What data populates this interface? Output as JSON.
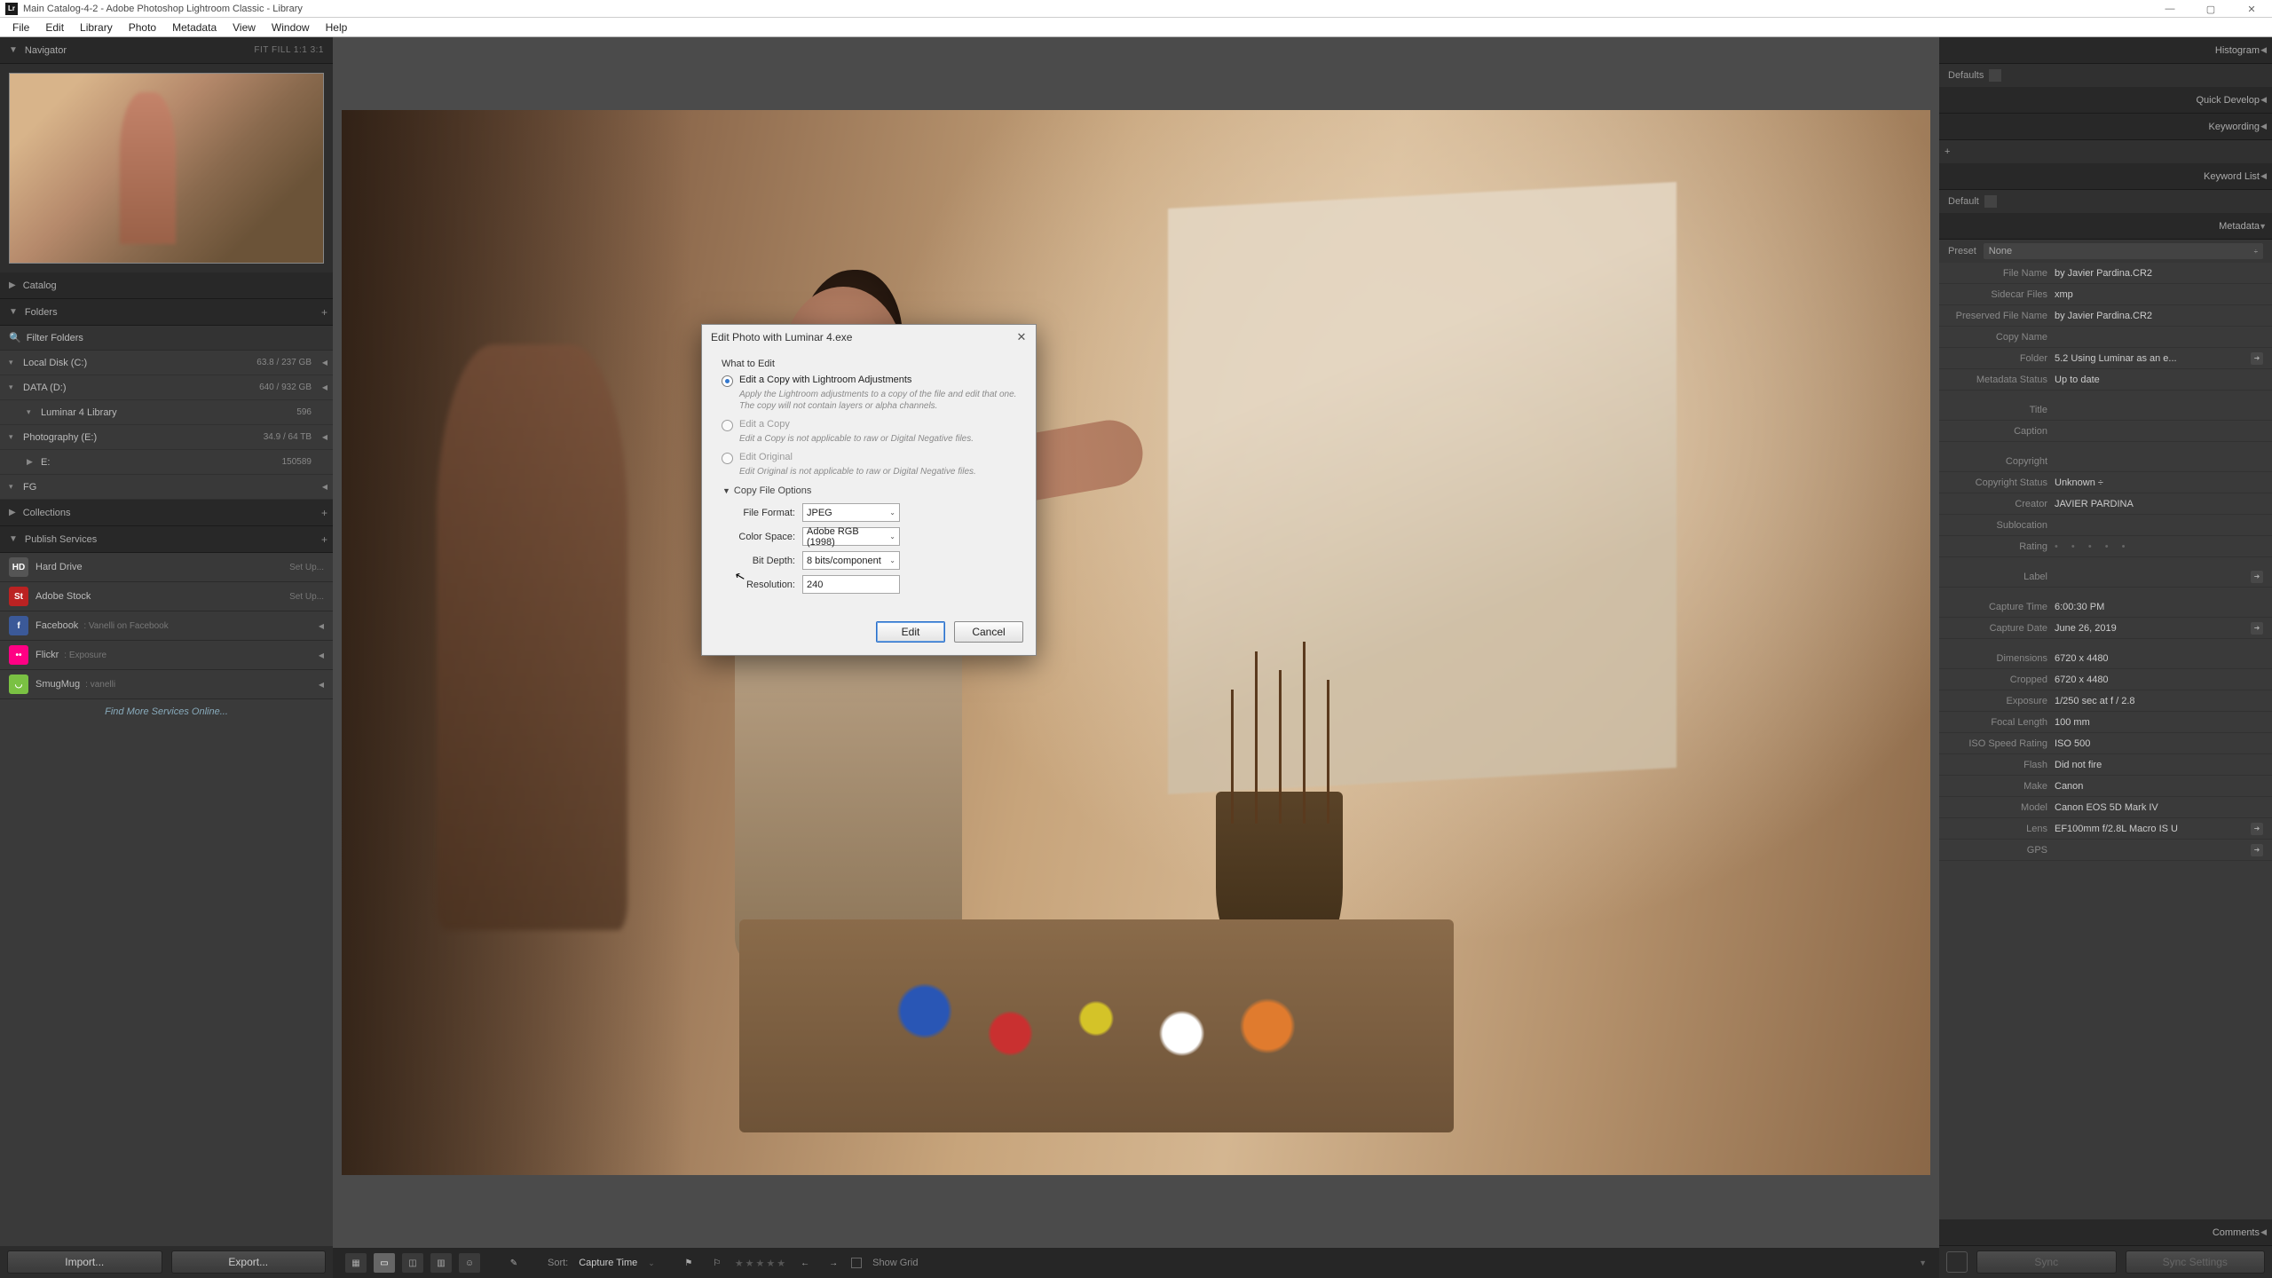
{
  "window": {
    "title": "Main Catalog-4-2 - Adobe Photoshop Lightroom Classic - Library"
  },
  "menu": [
    "File",
    "Edit",
    "Library",
    "Photo",
    "Metadata",
    "View",
    "Window",
    "Help"
  ],
  "left": {
    "navigator": {
      "title": "Navigator",
      "info": "FIT   FILL   1:1   3:1"
    },
    "catalog": {
      "title": "Catalog"
    },
    "folders": {
      "title": "Folders",
      "filter": "Filter Folders",
      "rows": [
        {
          "name": "Local Disk (C:)",
          "count": "63.8 / 237 GB",
          "tri": true
        },
        {
          "name": "DATA (D:)",
          "count": "640 / 932 GB",
          "tri": true
        },
        {
          "name": "Luminar 4 Library",
          "count": "596",
          "indent": 1,
          "tri": false
        },
        {
          "name": "Photography (E:)",
          "count": "34.9 / 64 TB",
          "tri": true
        },
        {
          "name": "E:",
          "count": "150589",
          "indent": 1,
          "tri": false,
          "chev": "▶"
        },
        {
          "name": "FG",
          "count": "",
          "tri": true
        }
      ]
    },
    "collections": {
      "title": "Collections"
    },
    "publish": {
      "title": "Publish Services",
      "rows": [
        {
          "icon": "HD",
          "bg": "#555",
          "name": "Hard Drive",
          "sub": "",
          "right": "Set Up..."
        },
        {
          "icon": "St",
          "bg": "#b22",
          "name": "Adobe Stock",
          "sub": "",
          "right": "Set Up..."
        },
        {
          "icon": "f",
          "bg": "#3b5998",
          "name": "Facebook",
          "sub": "Vanelli on Facebook",
          "right": "◀"
        },
        {
          "icon": "••",
          "bg": "#ff0084",
          "name": "Flickr",
          "sub": "Exposure",
          "right": "◀"
        },
        {
          "icon": "◡",
          "bg": "#7ac143",
          "name": "SmugMug",
          "sub": "vanelli",
          "right": "◀"
        }
      ],
      "find_more": "Find More Services Online..."
    },
    "import": "Import...",
    "export": "Export..."
  },
  "toolbar": {
    "sort_label": "Sort:",
    "sort_value": "Capture Time",
    "showgrid": "Show Grid"
  },
  "right": {
    "panels": [
      "Histogram",
      "Quick Develop",
      "Keywording",
      "Keyword List",
      "Metadata",
      "Comments"
    ],
    "defaults_label": "Defaults",
    "default_label": "Default",
    "preset_label": "Preset",
    "preset_value": "None",
    "metadata": [
      {
        "k": "File Name",
        "v": "by Javier Pardina.CR2"
      },
      {
        "k": "Sidecar Files",
        "v": "xmp"
      },
      {
        "k": "Preserved File Name",
        "v": "by Javier Pardina.CR2"
      },
      {
        "k": "Copy Name",
        "v": ""
      },
      {
        "k": "Folder",
        "v": "5.2 Using Luminar as an e...",
        "go": true
      },
      {
        "k": "Metadata Status",
        "v": "Up to date"
      },
      {
        "gap": true
      },
      {
        "k": "Title",
        "v": ""
      },
      {
        "k": "Caption",
        "v": ""
      },
      {
        "gap": true
      },
      {
        "k": "Copyright",
        "v": ""
      },
      {
        "k": "Copyright Status",
        "v": "Unknown  ÷"
      },
      {
        "k": "Creator",
        "v": "JAVIER PARDINA"
      },
      {
        "k": "Sublocation",
        "v": ""
      },
      {
        "k": "Rating",
        "v": "rating"
      },
      {
        "gap": true
      },
      {
        "k": "Label",
        "v": "",
        "go": true
      },
      {
        "gap": true
      },
      {
        "k": "Capture Time",
        "v": "6:00:30 PM"
      },
      {
        "k": "Capture Date",
        "v": "June 26, 2019",
        "go": true
      },
      {
        "gap": true
      },
      {
        "k": "Dimensions",
        "v": "6720 x 4480"
      },
      {
        "k": "Cropped",
        "v": "6720 x 4480"
      },
      {
        "k": "Exposure",
        "v": "1/250 sec at f / 2.8"
      },
      {
        "k": "Focal Length",
        "v": "100 mm"
      },
      {
        "k": "ISO Speed Rating",
        "v": "ISO 500"
      },
      {
        "k": "Flash",
        "v": "Did not fire"
      },
      {
        "k": "Make",
        "v": "Canon"
      },
      {
        "k": "Model",
        "v": "Canon EOS 5D Mark IV"
      },
      {
        "k": "Lens",
        "v": "EF100mm f/2.8L Macro IS U",
        "go": true
      },
      {
        "k": "GPS",
        "v": "",
        "go": true
      }
    ],
    "sync": "Sync",
    "sync_settings": "Sync Settings"
  },
  "dialog": {
    "title": "Edit Photo with Luminar 4.exe",
    "what_to_edit": "What to Edit",
    "options": [
      {
        "label": "Edit a Copy with Lightroom Adjustments",
        "desc": "Apply the Lightroom adjustments to a copy of the file and edit that one. The copy will not contain layers or alpha channels.",
        "checked": true,
        "disabled": false
      },
      {
        "label": "Edit a Copy",
        "desc": "Edit a Copy is not applicable to raw or Digital Negative files.",
        "checked": false,
        "disabled": true
      },
      {
        "label": "Edit Original",
        "desc": "Edit Original is not applicable to raw or Digital Negative files.",
        "checked": false,
        "disabled": true
      }
    ],
    "copy_options_title": "Copy File Options",
    "fields": [
      {
        "label": "File Format:",
        "value": "JPEG",
        "type": "select"
      },
      {
        "label": "Color Space:",
        "value": "Adobe RGB (1998)",
        "type": "select"
      },
      {
        "label": "Bit Depth:",
        "value": "8 bits/component",
        "type": "select"
      },
      {
        "label": "Resolution:",
        "value": "240",
        "type": "input"
      }
    ],
    "edit": "Edit",
    "cancel": "Cancel"
  }
}
